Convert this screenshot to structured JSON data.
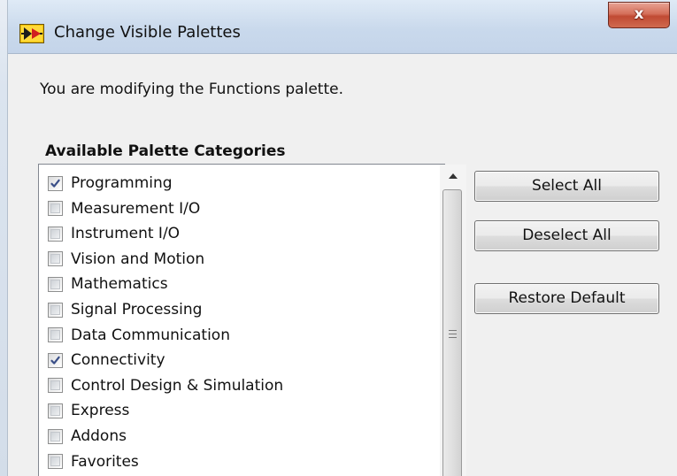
{
  "window": {
    "title": "Change Visible Palettes",
    "close_glyph": "x",
    "close_icon": "close-icon",
    "app_icon": "labview-app-icon"
  },
  "dialog": {
    "intro_text": "You are modifying the Functions palette.",
    "section_heading": "Available Palette Categories"
  },
  "categories": [
    {
      "label": "Programming",
      "checked": true
    },
    {
      "label": "Measurement I/O",
      "checked": false
    },
    {
      "label": "Instrument I/O",
      "checked": false
    },
    {
      "label": "Vision and Motion",
      "checked": false
    },
    {
      "label": "Mathematics",
      "checked": false
    },
    {
      "label": "Signal Processing",
      "checked": false
    },
    {
      "label": "Data Communication",
      "checked": false
    },
    {
      "label": "Connectivity",
      "checked": true
    },
    {
      "label": "Control Design & Simulation",
      "checked": false
    },
    {
      "label": "Express",
      "checked": false
    },
    {
      "label": "Addons",
      "checked": false
    },
    {
      "label": "Favorites",
      "checked": false
    }
  ],
  "buttons": {
    "select_all": "Select All",
    "deselect_all": "Deselect All",
    "restore_default": "Restore Default"
  },
  "scrollbar": {
    "up_arrow_icon": "scroll-up-arrow-icon",
    "grip_icon": "scroll-grip-icon"
  },
  "colors": {
    "title_bar": "#c9d9ec",
    "close_button": "#c75a43",
    "dialog_background": "#f0f0f0",
    "checkmark": "#3a4f88",
    "app_icon_yellow": "#f2c200"
  }
}
